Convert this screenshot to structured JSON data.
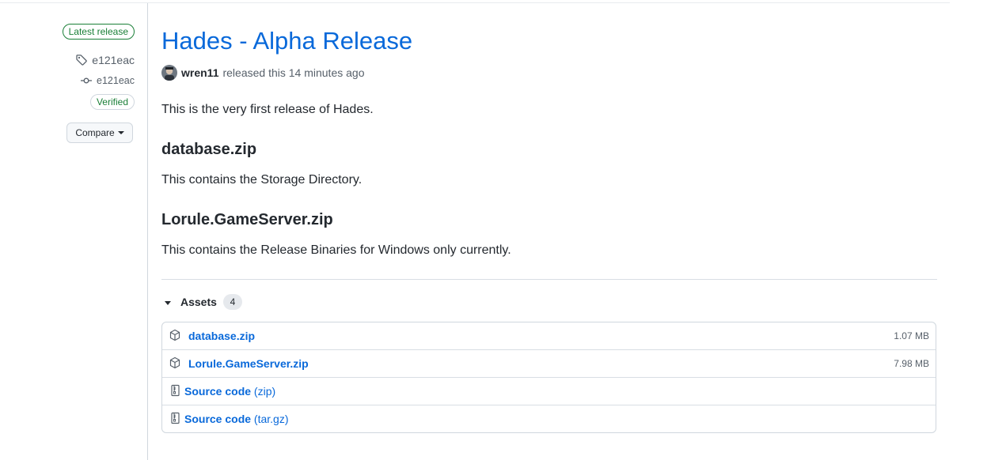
{
  "release": {
    "latest_badge": "Latest release",
    "tag": "e121eac",
    "commit": "e121eac",
    "verified_badge": "Verified",
    "compare_label": "Compare",
    "title": "Hades - Alpha Release",
    "author": "wren11",
    "released_text": "released this 14 minutes ago"
  },
  "body": {
    "intro": "This is the very first release of Hades.",
    "section1_heading": "database.zip",
    "section1_text": "This contains the Storage Directory.",
    "section2_heading": "Lorule.GameServer.zip",
    "section2_text": "This contains the Release Binaries for Windows only currently."
  },
  "assets": {
    "label": "Assets",
    "count": "4",
    "items": [
      {
        "name": "database.zip",
        "size": "1.07 MB",
        "icon": "package-icon"
      },
      {
        "name": "Lorule.GameServer.zip",
        "size": "7.98 MB",
        "icon": "package-icon"
      },
      {
        "name": "Source code",
        "suffix": "(zip)",
        "icon": "file-zip-icon"
      },
      {
        "name": "Source code",
        "suffix": "(tar.gz)",
        "icon": "file-zip-icon"
      }
    ]
  },
  "colors": {
    "link": "#0969da",
    "success": "#1a7f37",
    "muted": "#57606a",
    "border": "#d0d7de"
  }
}
